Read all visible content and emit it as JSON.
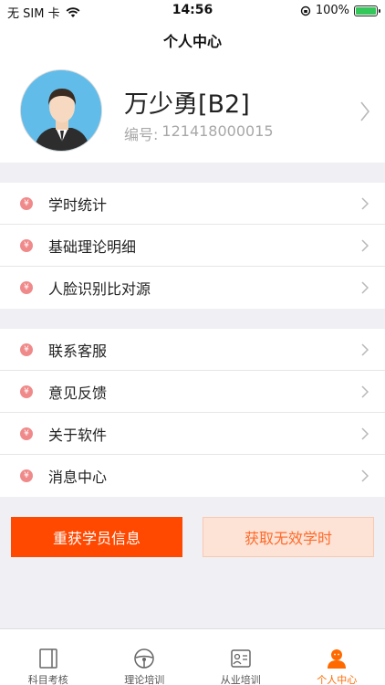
{
  "status_bar": {
    "carrier": "无 SIM 卡",
    "time": "14:56",
    "battery": "100%",
    "battery_level": 1.0,
    "icons": [
      "wifi-icon",
      "lock-rotation-icon",
      "battery-charging-icon"
    ]
  },
  "header": {
    "title": "个人中心"
  },
  "profile": {
    "name": "万少勇[B2]",
    "id_label": "编号:",
    "id_value": "121418000015"
  },
  "menu_groups": [
    {
      "items": [
        {
          "label": "学时统计"
        },
        {
          "label": "基础理论明细"
        },
        {
          "label": "人脸识别比对源"
        }
      ]
    },
    {
      "items": [
        {
          "label": "联系客服"
        },
        {
          "label": "意见反馈"
        },
        {
          "label": "关于软件"
        },
        {
          "label": "消息中心"
        }
      ]
    }
  ],
  "menu_icon_glyph": "¥",
  "actions": {
    "primary": "重获学员信息",
    "secondary": "获取无效学时"
  },
  "tabs": [
    {
      "label": "科目考核",
      "icon": "book-icon",
      "active": false
    },
    {
      "label": "理论培训",
      "icon": "steering-wheel-icon",
      "active": false
    },
    {
      "label": "从业培训",
      "icon": "id-card-icon",
      "active": false
    },
    {
      "label": "个人中心",
      "icon": "person-icon",
      "active": true
    }
  ],
  "colors": {
    "accent": "#ff4800",
    "accent_light": "#fde3d6",
    "menu_icon": "#f08a8a",
    "active_tab": "#ff6a00"
  }
}
